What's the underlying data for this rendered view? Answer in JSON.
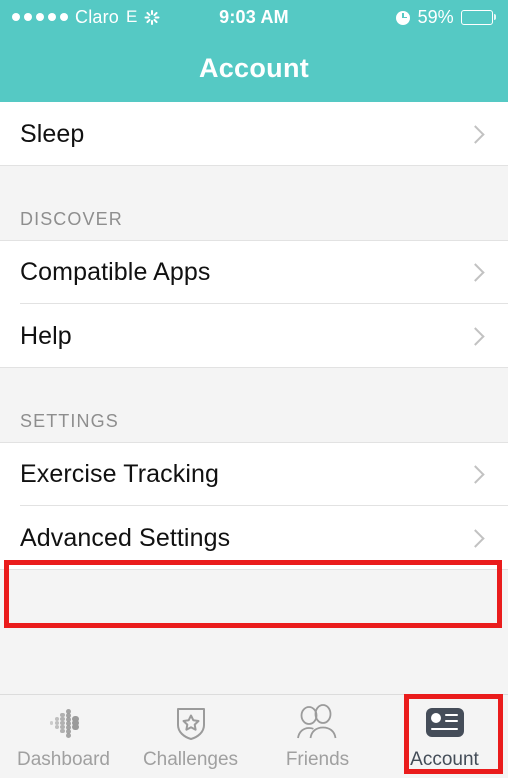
{
  "statusbar": {
    "carrier": "Claro",
    "network_type": "E",
    "activity_icon": "activity-spinner-icon",
    "time": "9:03 AM",
    "alarm_icon": "alarm-clock-icon",
    "battery_percent": "59%",
    "battery_level": 59,
    "battery_icon": "battery-icon"
  },
  "navbar": {
    "title": "Account",
    "background_color": "#55c9c4",
    "text_color": "#ffffff"
  },
  "list": {
    "top_rows": [
      {
        "label": "Sleep",
        "accessory": "chevron-right-icon"
      }
    ],
    "sections": [
      {
        "header": "DISCOVER",
        "rows": [
          {
            "label": "Compatible Apps",
            "accessory": "chevron-right-icon"
          },
          {
            "label": "Help",
            "accessory": "chevron-right-icon"
          }
        ]
      },
      {
        "header": "SETTINGS",
        "rows": [
          {
            "label": "Exercise Tracking",
            "accessory": "chevron-right-icon"
          },
          {
            "label": "Advanced Settings",
            "accessory": "chevron-right-icon"
          }
        ]
      }
    ]
  },
  "tabbar": {
    "tabs": [
      {
        "label": "Dashboard",
        "icon": "dashboard-dots-icon",
        "active": false
      },
      {
        "label": "Challenges",
        "icon": "shield-star-icon",
        "active": false
      },
      {
        "label": "Friends",
        "icon": "two-people-icon",
        "active": false
      },
      {
        "label": "Account",
        "icon": "id-card-icon",
        "active": true
      }
    ],
    "inactive_color": "#a0a0a0",
    "active_color": "#444d58"
  },
  "annotations": {
    "color": "#ea1c1c",
    "boxes": [
      {
        "name": "advanced-settings-highlight",
        "target": "Advanced Settings"
      },
      {
        "name": "account-tab-highlight",
        "target": "Account"
      }
    ]
  }
}
